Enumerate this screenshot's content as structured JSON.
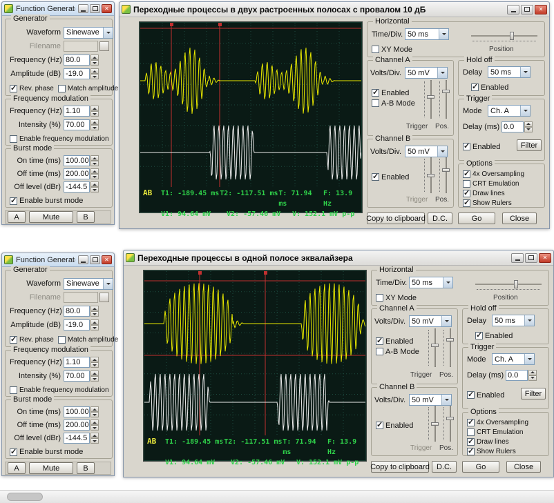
{
  "fg": {
    "title": "Function Generator",
    "generator": {
      "legend": "Generator",
      "waveform_label": "Waveform",
      "waveform_value": "Sinewave",
      "filename_label": "Filename",
      "frequency_label": "Frequency (Hz)",
      "frequency_value": "80.0",
      "amplitude_label": "Amplitude (dB)",
      "amplitude_value": "-19.0",
      "rev_phase": "Rev. phase",
      "match_amplitude": "Match amplitude"
    },
    "modulation": {
      "legend": "Frequency modulation",
      "frequency_label": "Frequency (Hz)",
      "frequency_value": "1.10",
      "intensity_label": "Intensity (%)",
      "intensity_value": "70.00",
      "enable": "Enable frequency modulation"
    },
    "burst": {
      "legend": "Burst mode",
      "on_time_label": "On time (ms)",
      "on_time_value": "100.00",
      "off_time_label": "Off time (ms)",
      "off_time_value": "200.00",
      "off_level_label": "Off level (dBr)",
      "off_level_value": "-144.5",
      "enable": "Enable burst mode"
    },
    "buttons": {
      "a": "A",
      "mute": "Mute",
      "b": "B"
    }
  },
  "scope": {
    "horizontal": {
      "legend": "Horizontal",
      "timediv_label": "Time/Div.",
      "timediv_value": "50 ms",
      "xy_mode": "XY Mode",
      "position_label": "Position"
    },
    "channel_a": {
      "legend": "Channel A",
      "voltsdiv_label": "Volts/Div.",
      "voltsdiv_value": "50 mV",
      "enabled": "Enabled",
      "ab_mode": "A-B Mode",
      "trigger_label": "Trigger",
      "pos_label": "Pos."
    },
    "channel_b": {
      "legend": "Channel B",
      "voltsdiv_label": "Volts/Div.",
      "voltsdiv_value": "50 mV",
      "enabled": "Enabled",
      "trigger_label": "Trigger",
      "pos_label": "Pos."
    },
    "hold_off": {
      "legend": "Hold off",
      "delay_label": "Delay",
      "delay_value": "50 ms",
      "enabled": "Enabled"
    },
    "trigger": {
      "legend": "Trigger",
      "mode_label": "Mode",
      "mode_value": "Ch. A",
      "delay_label": "Delay (ms)",
      "delay_value": "0.0",
      "enabled": "Enabled",
      "filter": "Filter"
    },
    "options": {
      "legend": "Options",
      "oversampling": "4x Oversampling",
      "crt": "CRT Emulation",
      "draw_lines": "Draw lines",
      "show_rulers": "Show Rulers"
    },
    "readout": {
      "ab": "AB",
      "t1": "T1: -189.45 ms",
      "t2": "T2: -117.51 ms",
      "t": "T: 71.94 ms",
      "f": "F: 13.9 Hz",
      "v1": "V1: 94.64 mV",
      "v2": "V2: -57.46 mV",
      "v": "V: 152.1 mV p-p"
    },
    "buttons": {
      "copy": "Copy to clipboard",
      "dc": "D.C.",
      "go": "Go",
      "close": "Close"
    }
  },
  "scope1": {
    "title": "Переходные процессы в двух растроенных полосах с провалом 10 дБ"
  },
  "scope2": {
    "title": "Переходные процессы в одной полосе эквалайзера"
  },
  "colors": {
    "screen_bg": "#0a1a15",
    "grid": "#1c4a3e",
    "cursor": "#c23030",
    "trace_a": "#e8e800",
    "trace_b": "#ececec",
    "readout_text": "#2fd24a",
    "ab_text": "#e6e63c"
  }
}
